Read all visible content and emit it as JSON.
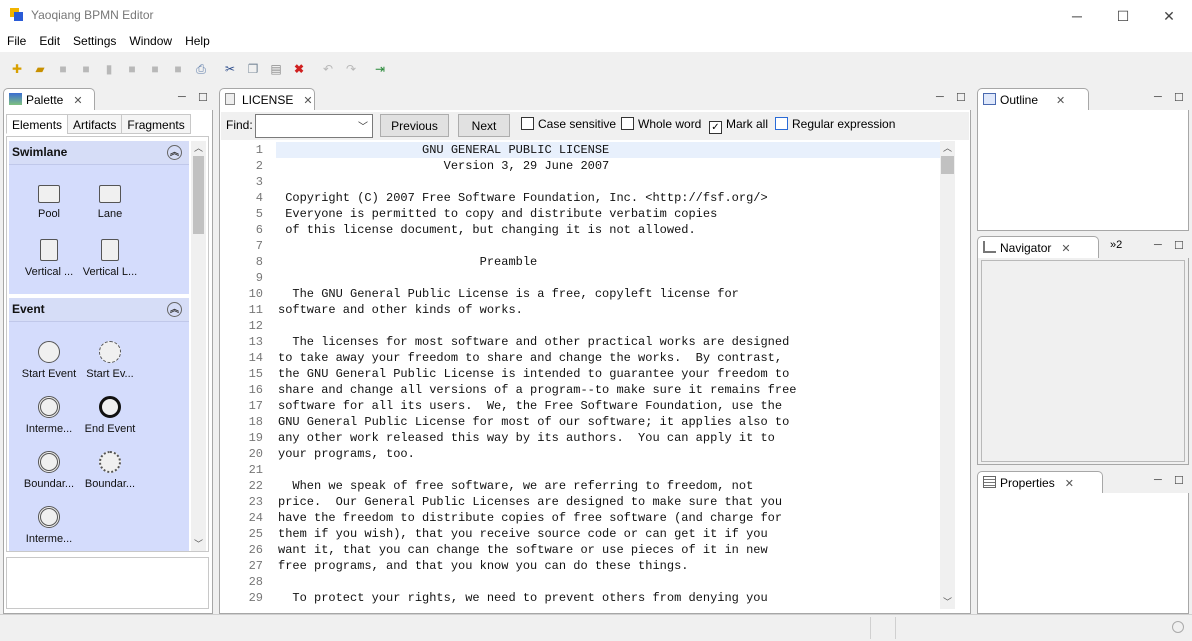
{
  "window": {
    "title": "Yaoqiang BPMN Editor",
    "minimize": "─",
    "maximize": "☐",
    "close": "✕"
  },
  "menu": [
    "File",
    "Edit",
    "Settings",
    "Window",
    "Help"
  ],
  "toolbar": {
    "icons": [
      "new-icon",
      "open-icon",
      "save-icon",
      "save-as-icon",
      "export-icon",
      "print-preview-icon",
      "image-icon",
      "copy-image-icon",
      "print-icon",
      "cut-icon",
      "copy-icon",
      "paste-icon",
      "delete-icon",
      "undo-icon",
      "redo-icon",
      "exit-icon"
    ]
  },
  "palette": {
    "tab": "Palette",
    "subtabs": [
      "Elements",
      "Artifacts",
      "Fragments"
    ],
    "swimlane": {
      "title": "Swimlane",
      "items": [
        "Pool",
        "Lane",
        "Vertical ...",
        "Vertical L..."
      ]
    },
    "event": {
      "title": "Event",
      "items": [
        "Start Event",
        "Start Ev...",
        "Interme...",
        "End Event",
        "Boundar...",
        "Boundar...",
        "Interme..."
      ]
    }
  },
  "editor": {
    "tab": "LICENSE",
    "find_label": "Find:",
    "find_value": "",
    "previous": "Previous",
    "next": "Next",
    "options": [
      {
        "label": "Case sensitive",
        "checked": false
      },
      {
        "label": "Whole word",
        "checked": false
      },
      {
        "label": "Mark all",
        "checked": true
      },
      {
        "label": "Regular expression",
        "checked": false
      }
    ],
    "lines": [
      "                    GNU GENERAL PUBLIC LICENSE",
      "                       Version 3, 29 June 2007",
      "",
      " Copyright (C) 2007 Free Software Foundation, Inc. <http://fsf.org/>",
      " Everyone is permitted to copy and distribute verbatim copies",
      " of this license document, but changing it is not allowed.",
      "",
      "                            Preamble",
      "",
      "  The GNU General Public License is a free, copyleft license for",
      "software and other kinds of works.",
      "",
      "  The licenses for most software and other practical works are designed",
      "to take away your freedom to share and change the works.  By contrast,",
      "the GNU General Public License is intended to guarantee your freedom to",
      "share and change all versions of a program--to make sure it remains free",
      "software for all its users.  We, the Free Software Foundation, use the",
      "GNU General Public License for most of our software; it applies also to",
      "any other work released this way by its authors.  You can apply it to",
      "your programs, too.",
      "",
      "  When we speak of free software, we are referring to freedom, not",
      "price.  Our General Public Licenses are designed to make sure that you",
      "have the freedom to distribute copies of free software (and charge for",
      "them if you wish), that you receive source code or can get it if you",
      "want it, that you can change the software or use pieces of it in new",
      "free programs, and that you know you can do these things.",
      "",
      "  To protect your rights, we need to prevent others from denying you"
    ]
  },
  "outline": {
    "tab": "Outline"
  },
  "navigator": {
    "tab": "Navigator",
    "overflow": "»2"
  },
  "properties": {
    "tab": "Properties"
  }
}
